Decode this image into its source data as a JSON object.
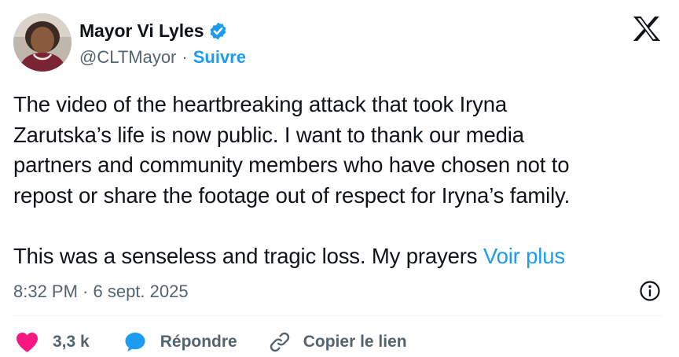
{
  "account": {
    "display_name": "Mayor Vi Lyles",
    "handle": "@CLTMayor",
    "separator": "·",
    "follow_label": "Suivre"
  },
  "tweet": {
    "text": "The video of the heartbreaking attack that took Iryna\nZarutska’s life is now public. I want to thank our media\npartners and community members who have chosen not to\nrepost or share the footage out of respect for Iryna’s family.\n\nThis was a senseless and tragic loss. My prayers ",
    "see_more_label": "Voir plus",
    "timestamp": "8:32 PM · 6 sept. 2025"
  },
  "actions": {
    "like_count": "3,3 k",
    "reply_label": "Répondre",
    "copy_link_label": "Copier le lien"
  },
  "colors": {
    "accent": "#1d9bf0",
    "like": "#f91880",
    "muted": "#536471",
    "text": "#0f1419"
  },
  "icons": [
    "verified-badge-icon",
    "x-logo-icon",
    "info-icon",
    "heart-icon",
    "reply-bubble-icon",
    "link-icon"
  ]
}
